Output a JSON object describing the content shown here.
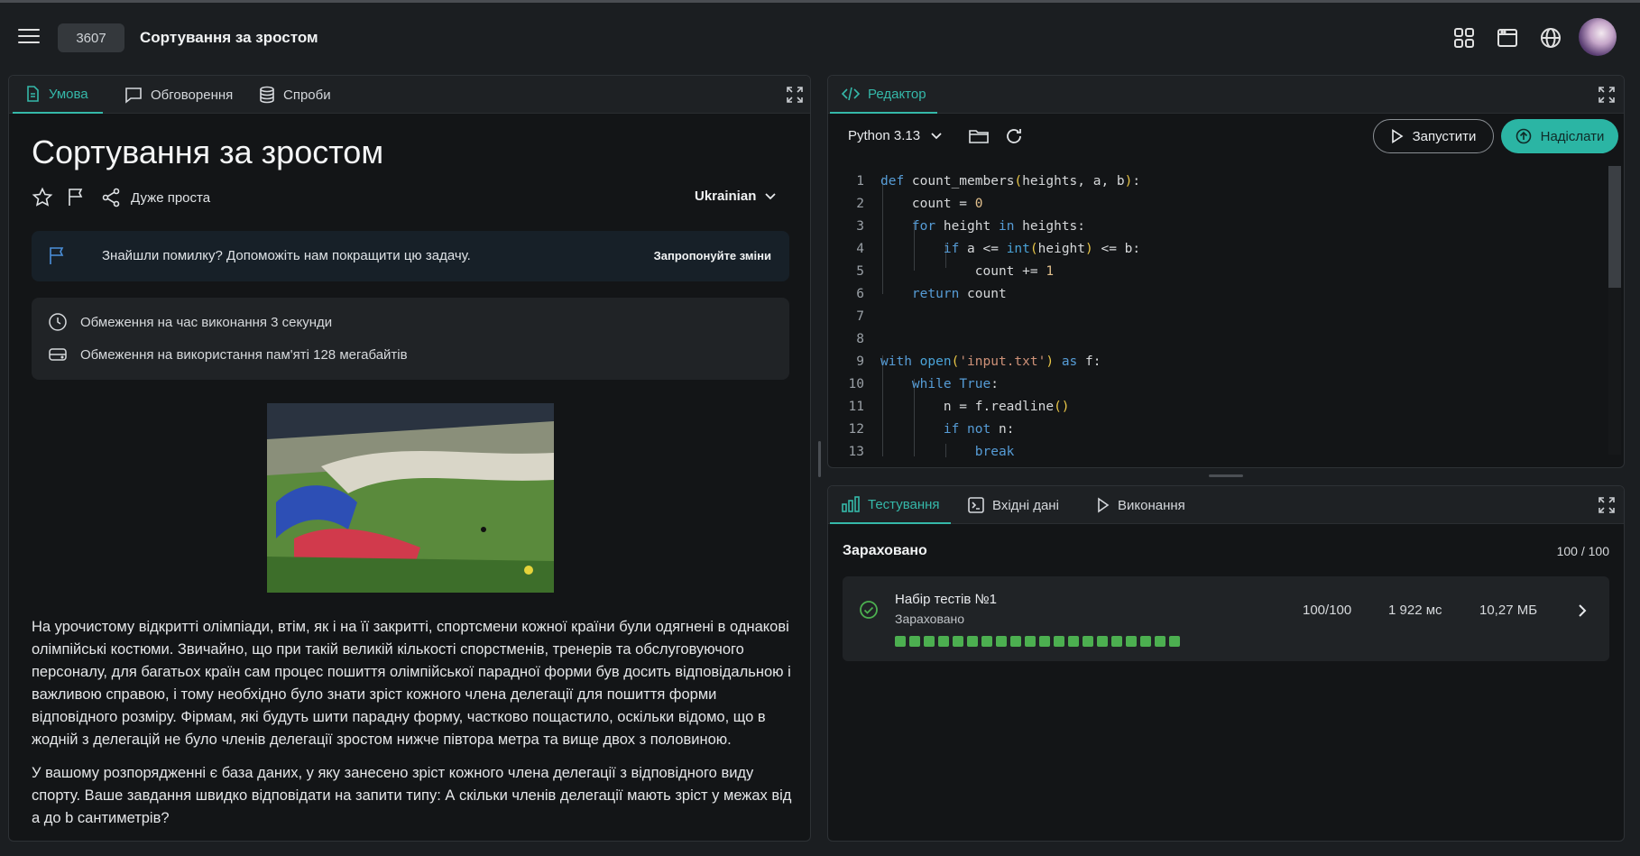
{
  "header": {
    "problem_id": "3607",
    "title": "Сортування за зростом"
  },
  "left_panel": {
    "tabs": [
      {
        "label": "Умова",
        "icon": "document-icon",
        "active": true
      },
      {
        "label": "Обговорення",
        "icon": "chat-icon",
        "active": false
      },
      {
        "label": "Спроби",
        "icon": "database-icon",
        "active": false
      }
    ],
    "problem_title": "Сортування за зростом",
    "difficulty": "Дуже проста",
    "language": "Ukrainian",
    "bug_report": {
      "text": "Знайшли помилку? Допоможіть нам покращити цю задачу.",
      "link": "Запропонуйте зміни"
    },
    "limits": {
      "time": "Обмеження на час виконання 3 секунди",
      "memory": "Обмеження на використання пам'яті 128 мегабайтів"
    },
    "statement": {
      "p1": "На урочистому відкритті олімпіади, втім, як і на її закритті, спортсмени кожної країни були одягнені в однакові олімпійські костюми. Звичайно, що при такій великій кількості спорстменів, тренерів та обслуговуючого персоналу, для багатьох країн сам процес пошиття олімпійської парадної форми був досить відповідальною і важливою справою, і тому необхідно було знати зріст кожного члена делегації для пошиття форми відповідного розміру. Фірмам, які будуть шити парадну форму, частково пощастило, оскільки відомо, що в жодній з делегацій не було членів делегації зростом нижче півтора метра та вище двох з половиною.",
      "p2": "У вашому розпорядженні є база даних, у яку занесено зріст кожного члена делегації з відповідного виду спорту. Ваше завдання швидко відповідати на запити типу: А скільки членів делегації мають зріст у межах від a до b сантиметрів?"
    }
  },
  "editor_panel": {
    "tab_label": "Редактор",
    "language": "Python 3.13",
    "run_label": "Запустити",
    "submit_label": "Надіслати",
    "code_lines": [
      "def count_members(heights, a, b):",
      "    count = 0",
      "    for height in heights:",
      "        if a <= int(height) <= b:",
      "            count += 1",
      "    return count",
      "",
      "",
      "with open('input.txt') as f:",
      "    while True:",
      "        n = f.readline()",
      "        if not n:",
      "            break"
    ]
  },
  "results_panel": {
    "tabs": [
      {
        "label": "Тестування",
        "icon": "bar-chart-icon",
        "active": true
      },
      {
        "label": "Вхідні дані",
        "icon": "terminal-icon",
        "active": false
      },
      {
        "label": "Виконання",
        "icon": "play-icon",
        "active": false
      }
    ],
    "status": "Зараховано",
    "score": "100 / 100",
    "test_set": {
      "name": "Набір тестів №1",
      "status": "Зараховано",
      "points": "100/100",
      "time": "1 922 мс",
      "memory": "10,27 МБ",
      "passed_tests": 20
    }
  },
  "colors": {
    "accent": "#2bb5a4",
    "pass": "#4caf50",
    "background": "#131517"
  }
}
